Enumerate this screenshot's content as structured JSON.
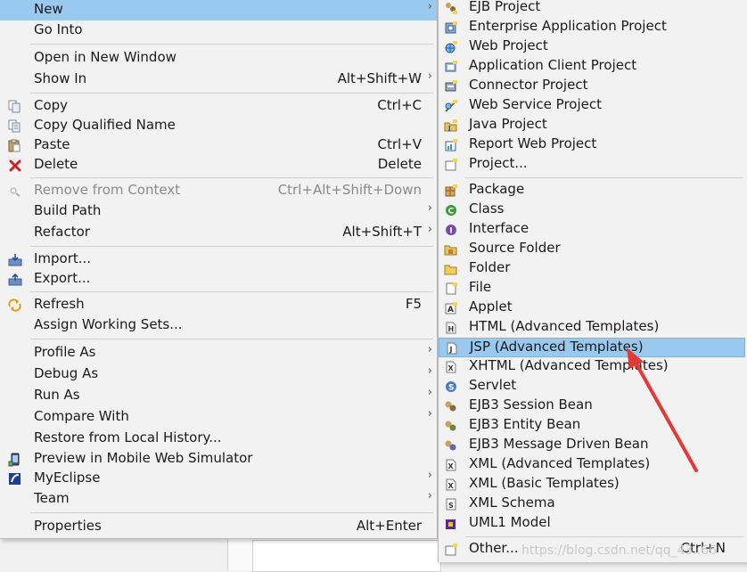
{
  "left_menu": {
    "items": [
      {
        "label": "New",
        "accel": "",
        "submenu": true,
        "selected": true,
        "icon": "none"
      },
      {
        "label": "Go Into",
        "accel": "",
        "submenu": false,
        "icon": "none"
      },
      {
        "label": "Open in New Window",
        "accel": "",
        "submenu": false,
        "icon": "none"
      },
      {
        "label": "Show In",
        "accel": "Alt+Shift+W",
        "submenu": true,
        "icon": "none"
      },
      {
        "label": "Copy",
        "accel": "Ctrl+C",
        "submenu": false,
        "icon": "copy-icon"
      },
      {
        "label": "Copy Qualified Name",
        "accel": "",
        "submenu": false,
        "icon": "copy-qualified-icon"
      },
      {
        "label": "Paste",
        "accel": "Ctrl+V",
        "submenu": false,
        "icon": "paste-icon"
      },
      {
        "label": "Delete",
        "accel": "Delete",
        "submenu": false,
        "icon": "delete-icon"
      },
      {
        "label": "Remove from Context",
        "accel": "Ctrl+Alt+Shift+Down",
        "submenu": false,
        "disabled": true,
        "icon": "remove-context-icon"
      },
      {
        "label": "Build Path",
        "accel": "",
        "submenu": true,
        "icon": "none"
      },
      {
        "label": "Refactor",
        "accel": "Alt+Shift+T",
        "submenu": true,
        "icon": "none"
      },
      {
        "label": "Import...",
        "accel": "",
        "submenu": false,
        "icon": "import-icon"
      },
      {
        "label": "Export...",
        "accel": "",
        "submenu": false,
        "icon": "export-icon"
      },
      {
        "label": "Refresh",
        "accel": "F5",
        "submenu": false,
        "icon": "refresh-icon"
      },
      {
        "label": "Assign Working Sets...",
        "accel": "",
        "submenu": false,
        "icon": "none"
      },
      {
        "label": "Profile As",
        "accel": "",
        "submenu": true,
        "icon": "none"
      },
      {
        "label": "Debug As",
        "accel": "",
        "submenu": true,
        "icon": "none"
      },
      {
        "label": "Run As",
        "accel": "",
        "submenu": true,
        "icon": "none"
      },
      {
        "label": "Compare With",
        "accel": "",
        "submenu": true,
        "icon": "none"
      },
      {
        "label": "Restore from Local History...",
        "accel": "",
        "submenu": false,
        "icon": "none"
      },
      {
        "label": "Preview in Mobile Web Simulator",
        "accel": "",
        "submenu": false,
        "icon": "mobile-simulator-icon"
      },
      {
        "label": "MyEclipse",
        "accel": "",
        "submenu": true,
        "icon": "myeclipse-icon"
      },
      {
        "label": "Team",
        "accel": "",
        "submenu": true,
        "icon": "none"
      },
      {
        "label": "Properties",
        "accel": "Alt+Enter",
        "submenu": false,
        "icon": "none"
      }
    ]
  },
  "submenu": {
    "items": [
      {
        "label": "EJB Project",
        "icon": "ejb-project-icon"
      },
      {
        "label": "Enterprise Application Project",
        "icon": "enterprise-app-icon"
      },
      {
        "label": "Web Project",
        "icon": "web-project-icon"
      },
      {
        "label": "Application Client Project",
        "icon": "app-client-icon"
      },
      {
        "label": "Connector Project",
        "icon": "connector-project-icon"
      },
      {
        "label": "Web Service Project",
        "icon": "web-service-icon"
      },
      {
        "label": "Java Project",
        "icon": "java-project-icon"
      },
      {
        "label": "Report Web Project",
        "icon": "report-web-icon"
      },
      {
        "label": "Project...",
        "icon": "project-icon"
      },
      {
        "label": "Package",
        "icon": "package-icon"
      },
      {
        "label": "Class",
        "icon": "class-icon"
      },
      {
        "label": "Interface",
        "icon": "interface-icon"
      },
      {
        "label": "Source Folder",
        "icon": "source-folder-icon"
      },
      {
        "label": "Folder",
        "icon": "folder-icon"
      },
      {
        "label": "File",
        "icon": "file-icon"
      },
      {
        "label": "Applet",
        "icon": "applet-icon"
      },
      {
        "label": "HTML (Advanced Templates)",
        "icon": "html-icon"
      },
      {
        "label": "JSP (Advanced Templates)",
        "icon": "jsp-icon",
        "selected": true
      },
      {
        "label": "XHTML (Advanced Templates)",
        "icon": "xhtml-icon"
      },
      {
        "label": "Servlet",
        "icon": "servlet-icon"
      },
      {
        "label": "EJB3 Session Bean",
        "icon": "session-bean-icon"
      },
      {
        "label": "EJB3 Entity Bean",
        "icon": "entity-bean-icon"
      },
      {
        "label": "EJB3 Message Driven Bean",
        "icon": "message-bean-icon"
      },
      {
        "label": "XML (Advanced Templates)",
        "icon": "xml-advanced-icon"
      },
      {
        "label": "XML (Basic Templates)",
        "icon": "xml-basic-icon"
      },
      {
        "label": "XML Schema",
        "icon": "xml-schema-icon"
      },
      {
        "label": "UML1 Model",
        "icon": "uml-model-icon"
      },
      {
        "label": "Other...",
        "accel": "Ctrl+N",
        "icon": "other-wizard-icon"
      }
    ]
  },
  "watermark": "https://blog.csdn.net/qq_43..66",
  "colors": {
    "selection": "#99c9ef",
    "menu_bg": "#f2f2f2",
    "arrow": "#e53935"
  }
}
